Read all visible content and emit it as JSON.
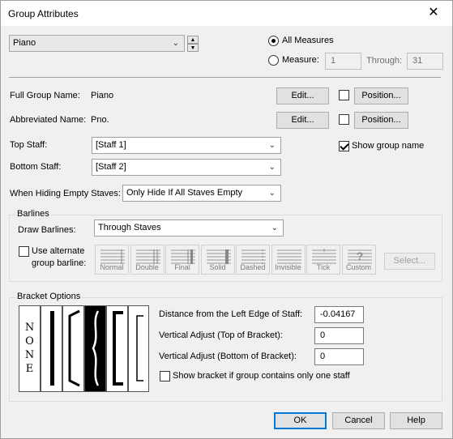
{
  "window": {
    "title": "Group Attributes"
  },
  "group_select": {
    "value": "Piano"
  },
  "measures": {
    "all_label": "All Measures",
    "measure_label": "Measure:",
    "from_value": "1",
    "through_label": "Through:",
    "through_value": "31"
  },
  "full_name": {
    "label": "Full Group Name:",
    "value": "Piano",
    "edit": "Edit...",
    "position": "Position..."
  },
  "abbr_name": {
    "label": "Abbreviated Name:",
    "value": "Pno.",
    "edit": "Edit...",
    "position": "Position..."
  },
  "top_staff": {
    "label": "Top Staff:",
    "value": "[Staff 1]"
  },
  "bottom_staff": {
    "label": "Bottom Staff:",
    "value": "[Staff 2]"
  },
  "show_group_name": "Show group name",
  "hiding": {
    "label": "When Hiding Empty Staves:",
    "value": "Only Hide If All Staves Empty"
  },
  "barlines": {
    "group_label": "Barlines",
    "draw_label": "Draw Barlines:",
    "draw_value": "Through Staves",
    "alternate_label_1": "Use alternate",
    "alternate_label_2": "group barline:",
    "types": [
      "Normal",
      "Double",
      "Final",
      "Solid",
      "Dashed",
      "Invisible",
      "Tick",
      "Custom"
    ],
    "select_button": "Select..."
  },
  "bracket": {
    "group_label": "Bracket Options",
    "none_letters": [
      "N",
      "O",
      "N",
      "E"
    ],
    "distance_label": "Distance from the Left Edge of Staff:",
    "distance_value": "-0.04167",
    "vtop_label": "Vertical Adjust (Top of Bracket):",
    "vtop_value": "0",
    "vbottom_label": "Vertical Adjust (Bottom of Bracket):",
    "vbottom_value": "0",
    "show_one_staff": "Show bracket if group contains only one staff"
  },
  "footer": {
    "ok": "OK",
    "cancel": "Cancel",
    "help": "Help"
  }
}
